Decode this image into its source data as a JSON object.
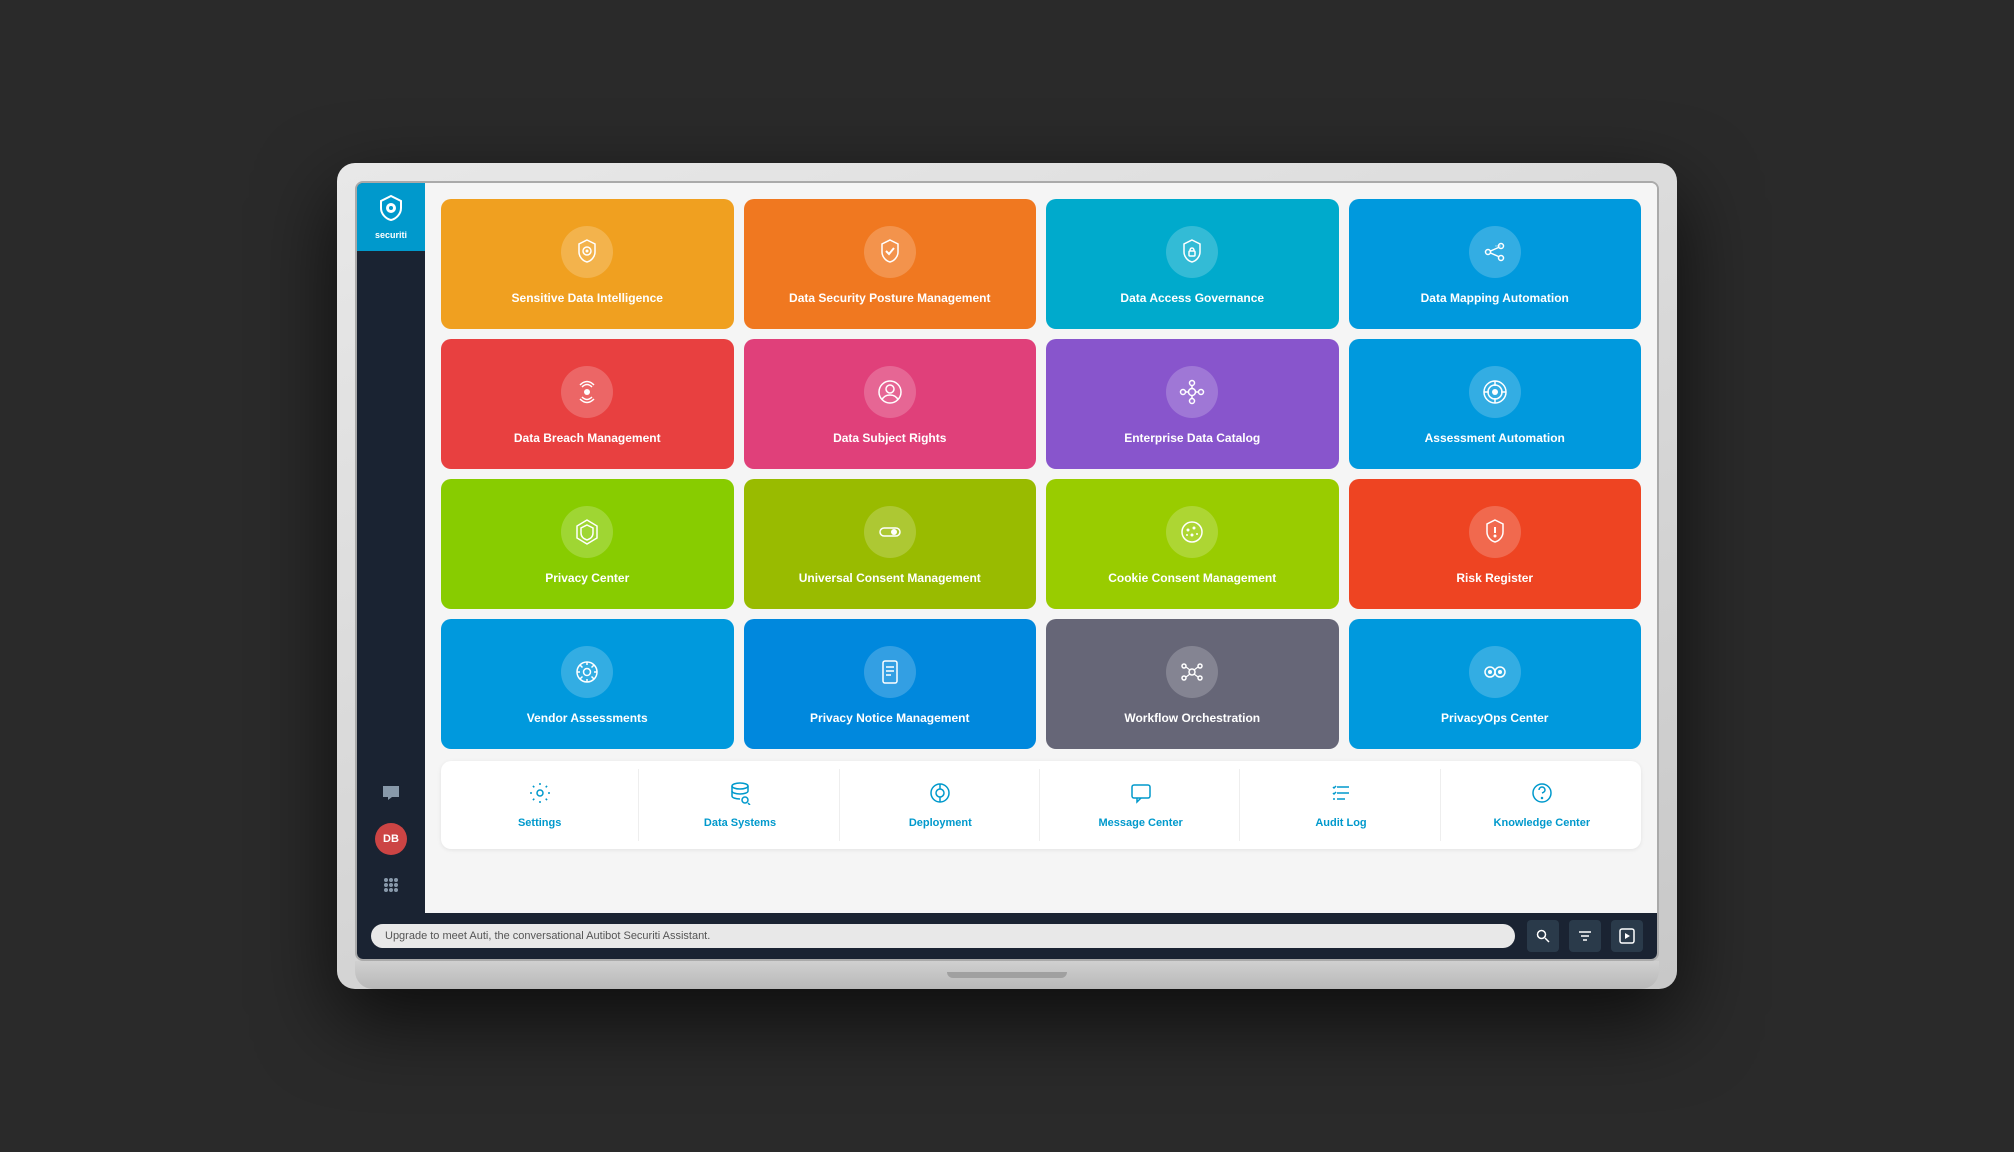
{
  "app": {
    "name": "securiti",
    "logo_text": "securiti"
  },
  "sidebar": {
    "avatar_initials": "DB",
    "avatar_bg": "#cc4444"
  },
  "tiles": [
    {
      "id": "sensitive-data-intelligence",
      "label": "Sensitive Data Intelligence",
      "bg": "#f0a020",
      "icon": "shield-gear"
    },
    {
      "id": "data-security-posture-management",
      "label": "Data Security Posture Management",
      "bg": "#f07820",
      "icon": "shield-check"
    },
    {
      "id": "data-access-governance",
      "label": "Data Access Governance",
      "bg": "#00aacc",
      "icon": "shield-lock"
    },
    {
      "id": "data-mapping-automation",
      "label": "Data Mapping Automation",
      "bg": "#0099dd",
      "icon": "share-nodes"
    },
    {
      "id": "data-breach-management",
      "label": "Data Breach Management",
      "bg": "#e84040",
      "icon": "broadcast"
    },
    {
      "id": "data-subject-rights",
      "label": "Data Subject Rights",
      "bg": "#e0407a",
      "icon": "user-circle"
    },
    {
      "id": "enterprise-data-catalog",
      "label": "Enterprise Data Catalog",
      "bg": "#8855cc",
      "icon": "nodes"
    },
    {
      "id": "assessment-automation",
      "label": "Assessment Automation",
      "bg": "#0099dd",
      "icon": "target-circle"
    },
    {
      "id": "privacy-center",
      "label": "Privacy Center",
      "bg": "#88cc00",
      "icon": "hexagon-shield"
    },
    {
      "id": "universal-consent-management",
      "label": "Universal Consent Management",
      "bg": "#99bb00",
      "icon": "toggle"
    },
    {
      "id": "cookie-consent-management",
      "label": "Cookie Consent Management",
      "bg": "#99cc00",
      "icon": "cookie"
    },
    {
      "id": "risk-register",
      "label": "Risk Register",
      "bg": "#ee4422",
      "icon": "shield-exclaim"
    },
    {
      "id": "vendor-assessments",
      "label": "Vendor Assessments",
      "bg": "#0099dd",
      "icon": "settings-circle"
    },
    {
      "id": "privacy-notice-management",
      "label": "Privacy Notice Management",
      "bg": "#0088dd",
      "icon": "document"
    },
    {
      "id": "workflow-orchestration",
      "label": "Workflow Orchestration",
      "bg": "#666677",
      "icon": "network"
    },
    {
      "id": "privacyops-center",
      "label": "PrivacyOps Center",
      "bg": "#0099dd",
      "icon": "eyes"
    }
  ],
  "tools": [
    {
      "id": "settings",
      "label": "Settings",
      "icon": "gear"
    },
    {
      "id": "data-systems",
      "label": "Data Systems",
      "icon": "database-search"
    },
    {
      "id": "deployment",
      "label": "Deployment",
      "icon": "deploy-circle"
    },
    {
      "id": "message-center",
      "label": "Message Center",
      "icon": "chat-bubble"
    },
    {
      "id": "audit-log",
      "label": "Audit Log",
      "icon": "list-check"
    },
    {
      "id": "knowledge-center",
      "label": "Knowledge Center",
      "icon": "help-circle"
    }
  ],
  "bottom_bar": {
    "chat_text": "Upgrade to meet Auti, the conversational Autibot Securiti Assistant."
  }
}
